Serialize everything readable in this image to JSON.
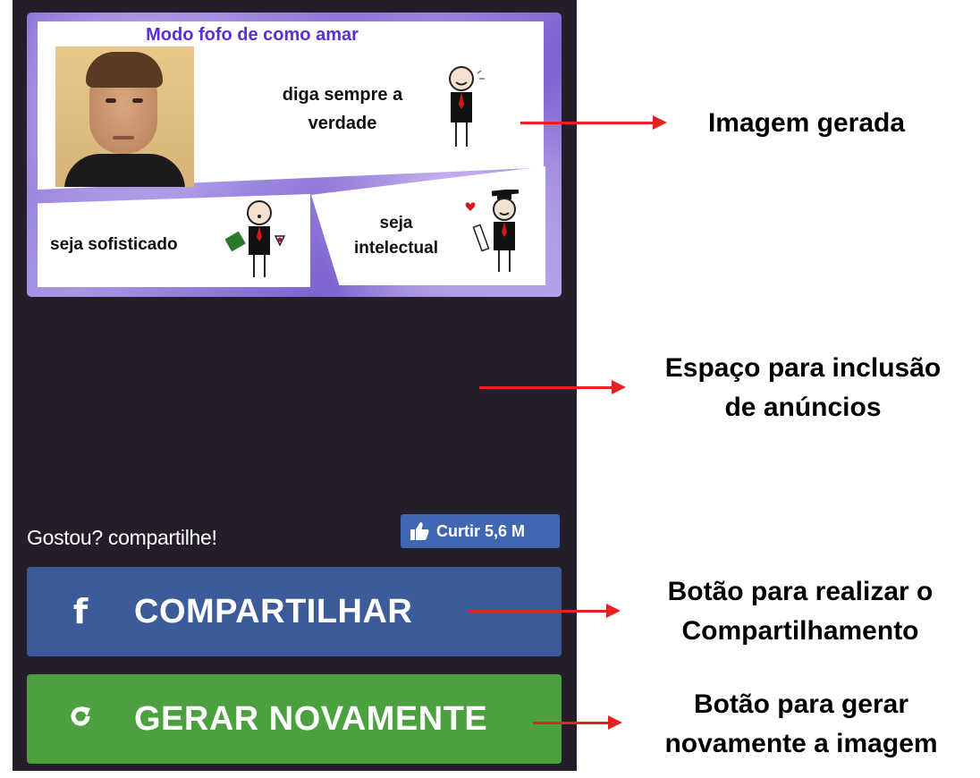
{
  "card": {
    "title": "Modo fofo de como amar",
    "panels": [
      {
        "text_line1": "diga sempre a",
        "text_line2": "verdade"
      },
      {
        "text": "seja sofisticado"
      },
      {
        "text_line1": "seja",
        "text_line2": "intelectual"
      }
    ]
  },
  "share": {
    "prompt": "Gostou? compartilhe!",
    "like_label": "Curtir 5,6 M",
    "like_icon": "thumbs-up-icon"
  },
  "buttons": {
    "share_label": "COMPARTILHAR",
    "share_icon": "facebook-icon",
    "regen_label": "GERAR NOVAMENTE",
    "regen_icon": "refresh-icon"
  },
  "annotations": {
    "image": "Imagem gerada",
    "ads_line1": "Espaço para inclusão",
    "ads_line2": "de anúncios",
    "share_line1": "Botão para realizar o",
    "share_line2": "Compartilhamento",
    "regen_line1": "Botão para gerar",
    "regen_line2": "novamente a imagem"
  },
  "colors": {
    "app_background": "#231e29",
    "share_button": "#3c5b9a",
    "regen_button": "#4aa13d",
    "like_button": "#4267b2",
    "title_purple": "#5b2fd1",
    "arrow_red": "#e52222"
  }
}
